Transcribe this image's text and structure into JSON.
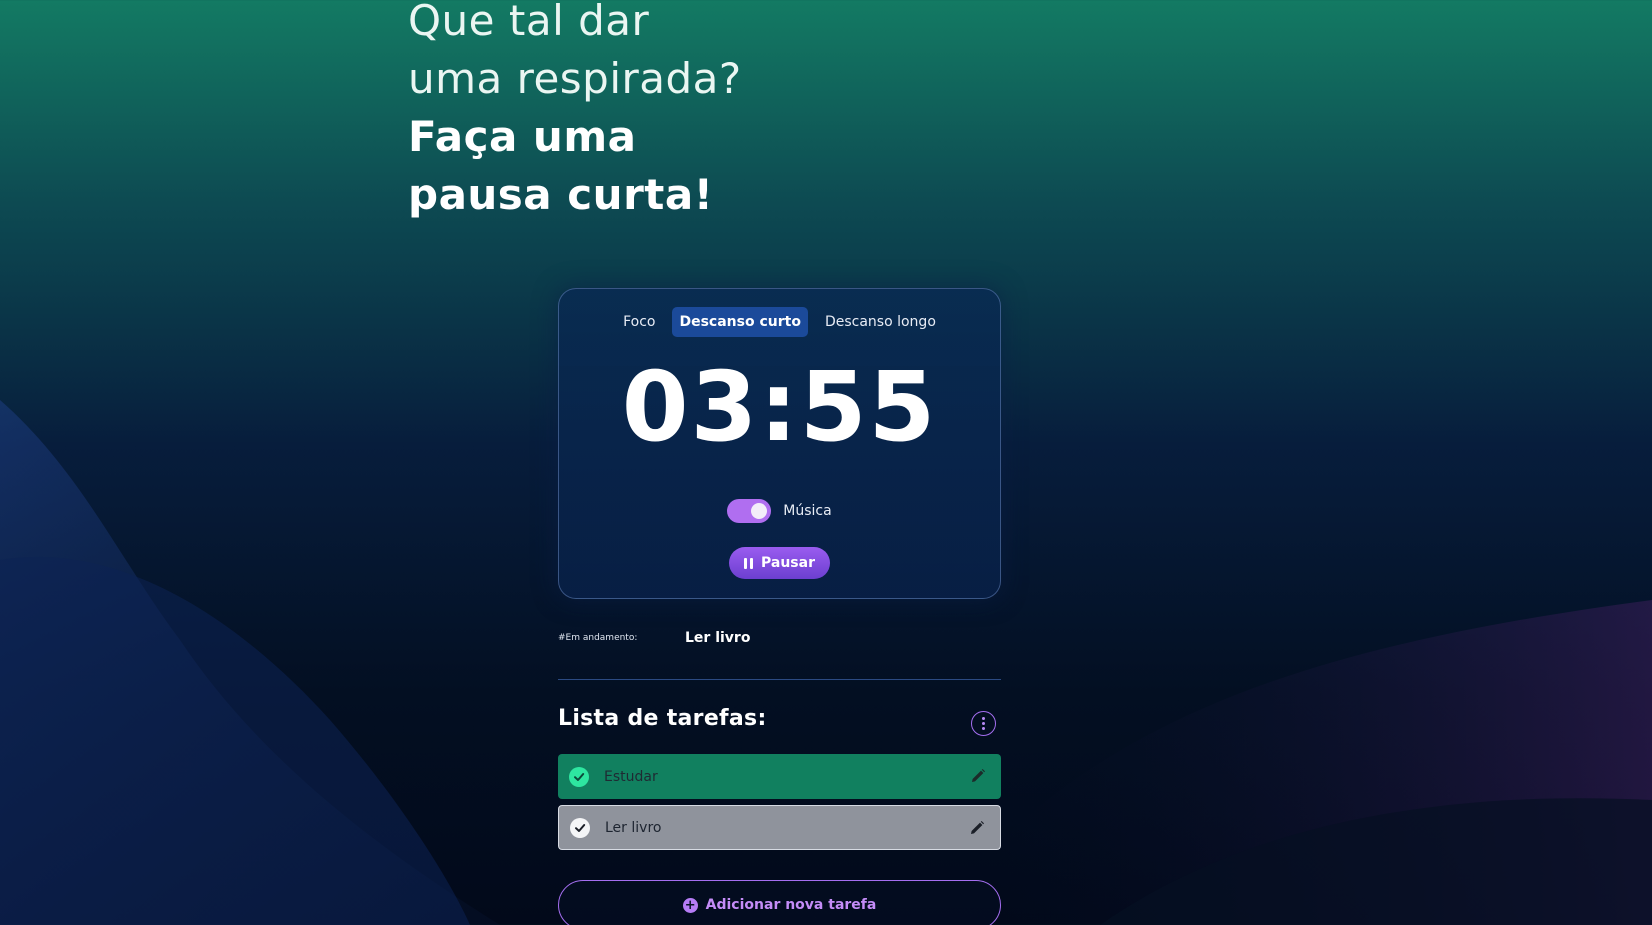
{
  "headline": {
    "line1": "Que tal dar",
    "line2": "uma respirada?",
    "line3": "Faça uma",
    "line4": "pausa curta!"
  },
  "timer": {
    "tabs": [
      {
        "label": "Foco",
        "active": false
      },
      {
        "label": "Descanso curto",
        "active": true
      },
      {
        "label": "Descanso longo",
        "active": false
      }
    ],
    "time": "03:55",
    "music_label": "Música",
    "music_on": true,
    "pause_label": "Pausar"
  },
  "in_progress": {
    "label": "#Em andamento:",
    "task": "Ler livro"
  },
  "task_list": {
    "title": "Lista de tarefas:",
    "items": [
      {
        "name": "Estudar",
        "status": "done"
      },
      {
        "name": "Ler livro",
        "status": "current"
      }
    ],
    "add_label": "Adicionar nova tarefa"
  },
  "colors": {
    "accent_purple": "#a46ef0",
    "done_green": "#11805f",
    "active_tab": "#1b4a9a"
  },
  "icons": [
    "pause-icon",
    "check-icon",
    "edit-pencil-icon",
    "more-vertical-icon",
    "add-circle-icon"
  ]
}
